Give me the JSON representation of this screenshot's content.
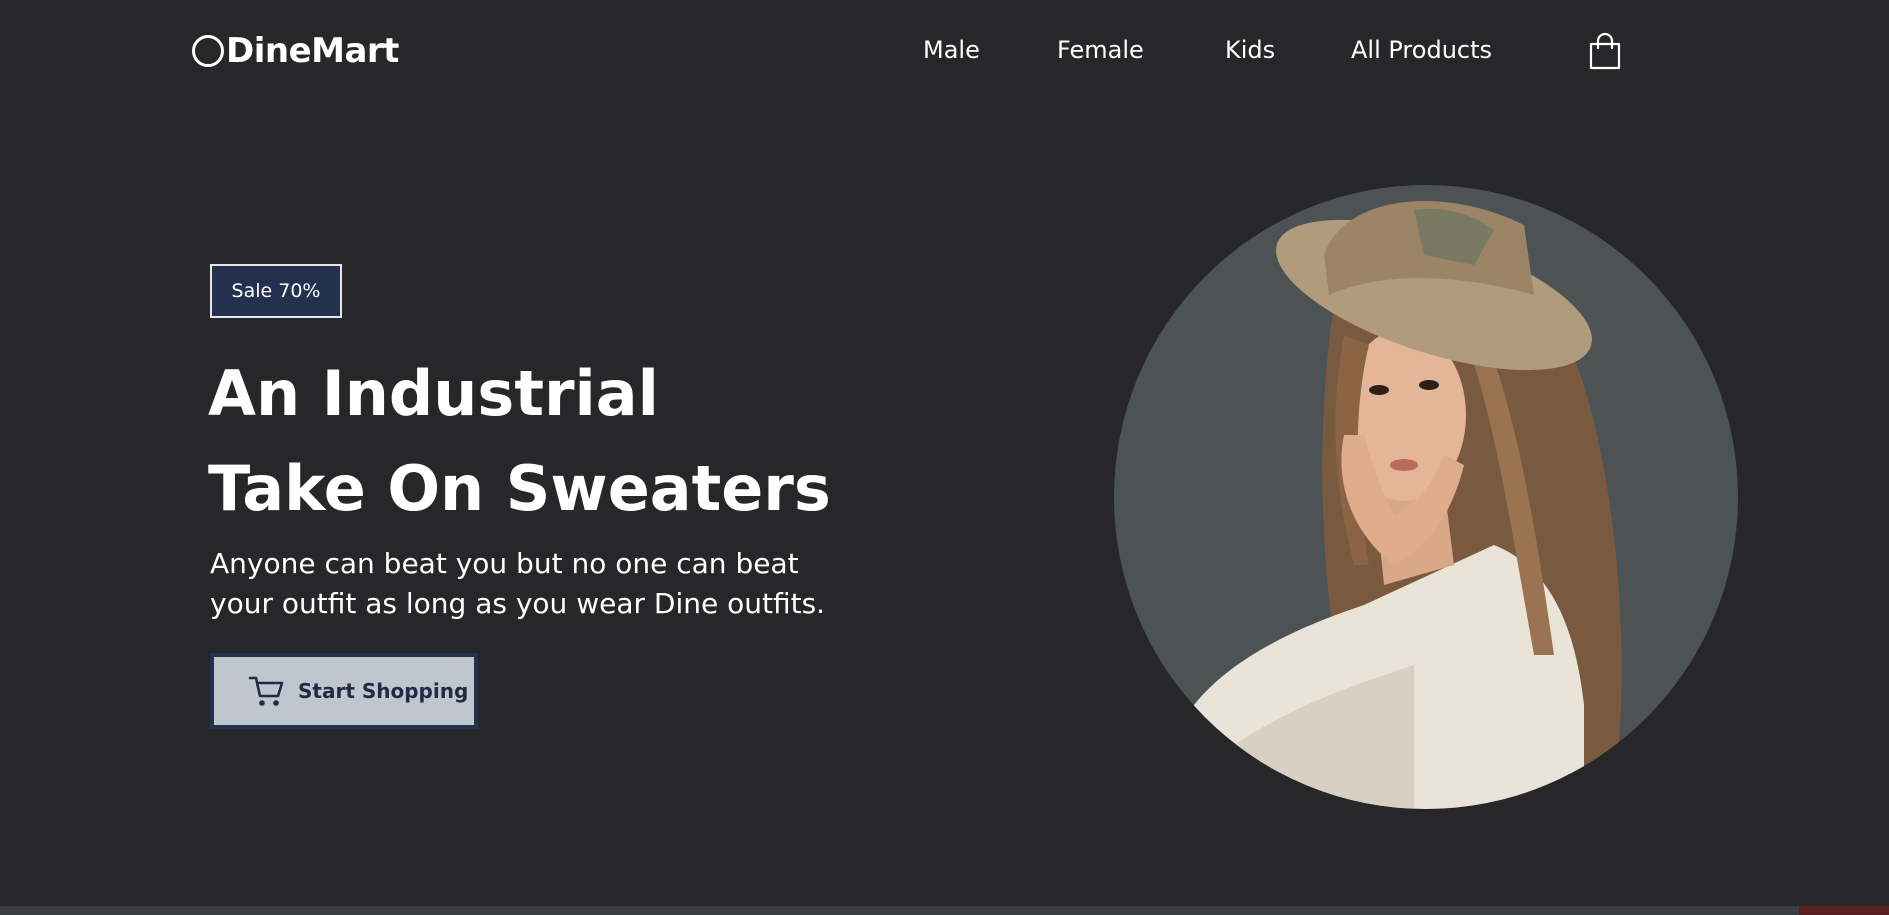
{
  "brand": {
    "name": "DineMart",
    "logo_icon": "circle-logo-icon"
  },
  "nav": {
    "items": [
      {
        "label": "Male"
      },
      {
        "label": "Female"
      },
      {
        "label": "Kids"
      },
      {
        "label": "All Products"
      }
    ],
    "cart_icon": "shopping-bag-icon"
  },
  "hero": {
    "badge": "Sale 70%",
    "headline_line1": "An Industrial",
    "headline_line2": "Take On Sweaters",
    "subtext_line1": "Anyone can beat you but no one can beat",
    "subtext_line2": "your outfit as long as you wear Dine outfits.",
    "cta_label": "Start Shopping",
    "cta_icon": "shopping-cart-icon",
    "image_description_icon": "model-photo"
  },
  "colors": {
    "background": "#27272a",
    "badge_bg": "#23304e",
    "cta_bg": "#bfc6cd",
    "cta_text": "#1f2b45",
    "circle_bg": "#4d5255"
  }
}
